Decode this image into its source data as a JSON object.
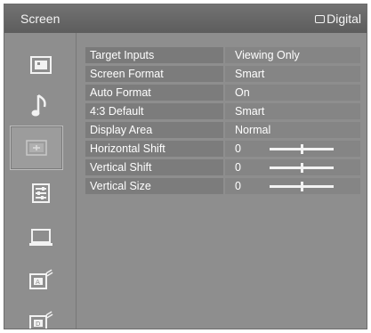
{
  "header": {
    "title": "Screen",
    "source_label": "Digital"
  },
  "sidebar": {
    "items": [
      {
        "name": "picture-icon"
      },
      {
        "name": "sound-icon"
      },
      {
        "name": "screen-icon",
        "selected": true
      },
      {
        "name": "setup-icon"
      },
      {
        "name": "monitor-icon"
      },
      {
        "name": "analog-setup-icon"
      },
      {
        "name": "digital-setup-icon"
      }
    ]
  },
  "settings": [
    {
      "label": "Target Inputs",
      "value": "Viewing Only"
    },
    {
      "label": "Screen Format",
      "value": "Smart"
    },
    {
      "label": "Auto Format",
      "value": "On"
    },
    {
      "label": "4:3 Default",
      "value": "Smart"
    },
    {
      "label": "Display Area",
      "value": "Normal"
    },
    {
      "label": "Horizontal Shift",
      "value": "0",
      "slider_fraction": 0.5
    },
    {
      "label": "Vertical Shift",
      "value": "0",
      "slider_fraction": 0.5
    },
    {
      "label": "Vertical Size",
      "value": "0",
      "slider_fraction": 0.5
    }
  ]
}
